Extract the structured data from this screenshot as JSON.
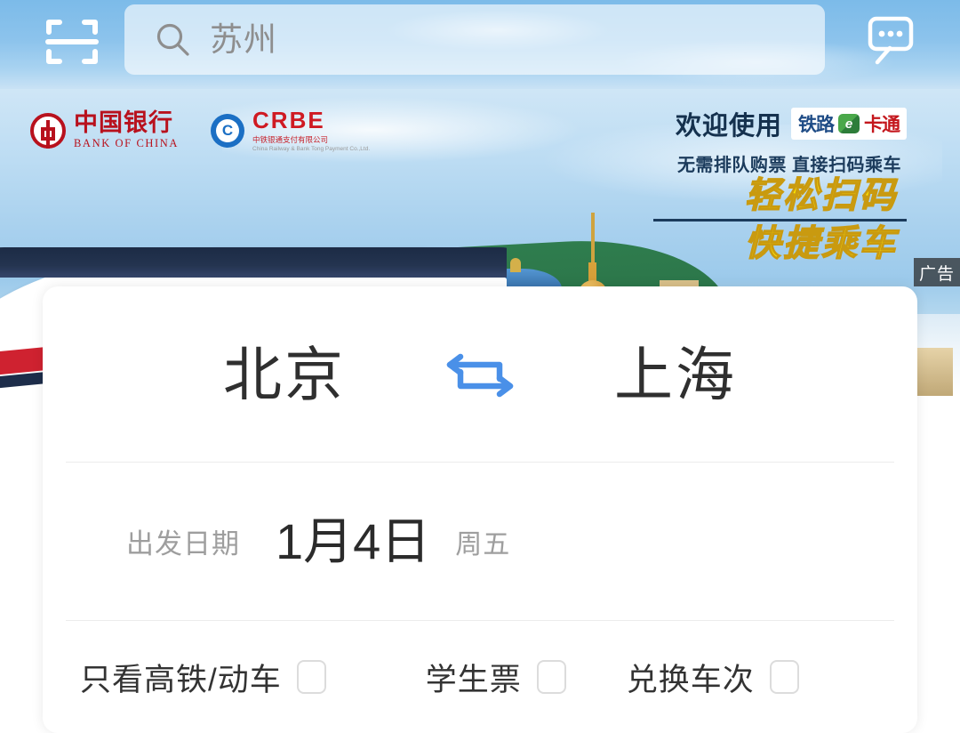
{
  "header": {
    "scan_icon": "qr-scan-icon",
    "search": {
      "icon": "search-icon",
      "placeholder": "苏州",
      "value": ""
    },
    "message_icon": "message-bubble-icon"
  },
  "banner": {
    "ad_label": "广告",
    "sponsor_bank_cn": "中国银行",
    "sponsor_bank_en": "BANK OF CHINA",
    "sponsor_crbe_mark": "C",
    "sponsor_crbe_name": "CRBE",
    "sponsor_crbe_sub1": "中铁银通支付有限公司",
    "sponsor_crbe_sub2": "China Railway & Bank Tong Payment Co.,Ltd.",
    "welcome": "欢迎使用",
    "ecard_part1": "铁路",
    "ecard_part2": "e",
    "ecard_part3": "卡通",
    "subtitle": "无需排队购票 直接扫码乘车",
    "slogan_line1": "轻松扫码",
    "slogan_line2": "快捷乘车"
  },
  "search_card": {
    "from_station": "北京",
    "to_station": "上海",
    "swap_icon": "swap-arrows-icon",
    "date_label": "出发日期",
    "date_value": "1月4日",
    "date_weekday": "周五",
    "options": [
      {
        "label": "只看高铁/动车",
        "checked": false
      },
      {
        "label": "学生票",
        "checked": false
      },
      {
        "label": "兑换车次",
        "checked": false
      }
    ]
  },
  "colors": {
    "accent_blue": "#4a90e2",
    "sky_blue": "#8cc3ec",
    "brand_red": "#b8111d",
    "slogan_yellow": "#ffe800",
    "text_dark": "#2f2f2f",
    "text_muted": "#9e9e9e"
  }
}
